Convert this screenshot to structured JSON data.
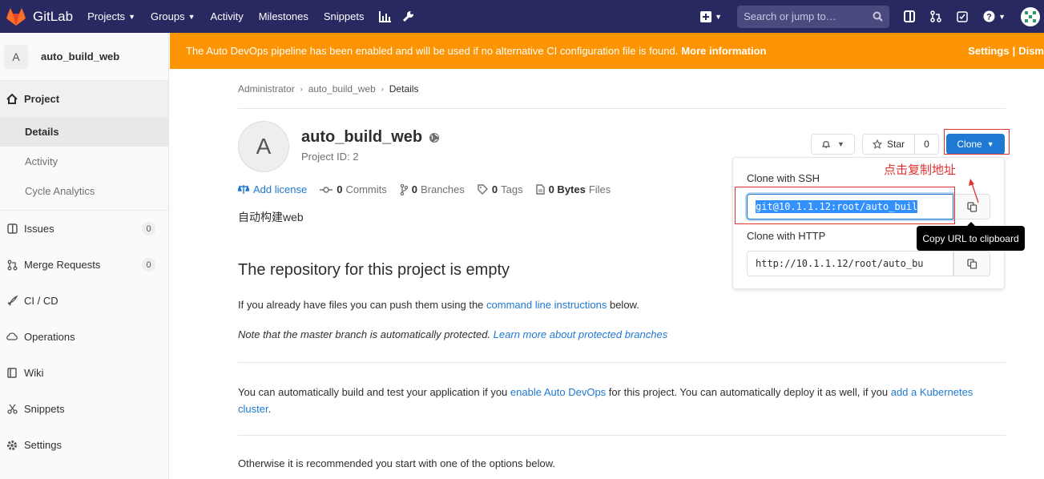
{
  "topnav": {
    "brand": "GitLab",
    "links": [
      "Projects",
      "Groups",
      "Activity",
      "Milestones",
      "Snippets"
    ],
    "search_placeholder": "Search or jump to…"
  },
  "sidebar": {
    "project_avatar_letter": "A",
    "project_name": "auto_build_web",
    "project_label": "Project",
    "sub_items": [
      "Details",
      "Activity",
      "Cycle Analytics"
    ],
    "items": [
      {
        "label": "Issues",
        "count": "0"
      },
      {
        "label": "Merge Requests",
        "count": "0"
      },
      {
        "label": "CI / CD"
      },
      {
        "label": "Operations"
      },
      {
        "label": "Wiki"
      },
      {
        "label": "Snippets"
      },
      {
        "label": "Settings"
      }
    ]
  },
  "banner": {
    "text": "The Auto DevOps pipeline has been enabled and will be used if no alternative CI configuration file is found.",
    "link": "More information",
    "settings": "Settings",
    "sep": "|",
    "dismiss": "Dism"
  },
  "breadcrumb": [
    "Administrator",
    "auto_build_web",
    "Details"
  ],
  "project": {
    "avatar_letter": "A",
    "name": "auto_build_web",
    "id_text": "Project ID: 2",
    "description": "自动构建web"
  },
  "stats": {
    "license": "Add license",
    "commits_count": "0",
    "commits_label": "Commits",
    "branches_count": "0",
    "branches_label": "Branches",
    "tags_count": "0",
    "tags_label": "Tags",
    "files_count": "0 Bytes",
    "files_label": "Files"
  },
  "actions": {
    "star_label": "Star",
    "star_count": "0",
    "clone_label": "Clone"
  },
  "clone_dropdown": {
    "ssh_label": "Clone with SSH",
    "ssh_url": "git@10.1.1.12:root/auto_buil",
    "http_label": "Clone with HTTP",
    "http_url": "http://10.1.1.12/root/auto_bu",
    "tooltip": "Copy URL to clipboard"
  },
  "annotation": "点击复制地址",
  "empty": {
    "heading": "The repository for this project is empty",
    "p1_pre": "If you already have files you can push them using the",
    "p1_link": "command line instructions",
    "p1_post": "below.",
    "p2_pre": "Note that the master branch is automatically protected.",
    "p2_link": "Learn more about protected branches",
    "p3_pre": "You can automatically build and test your application if you",
    "p3_link1": "enable Auto DevOps",
    "p3_mid": "for this project. You can automatically deploy it as well, if you",
    "p3_link2": "add a Kubernetes cluster",
    "p3_post": ".",
    "p4": "Otherwise it is recommended you start with one of the options below."
  }
}
